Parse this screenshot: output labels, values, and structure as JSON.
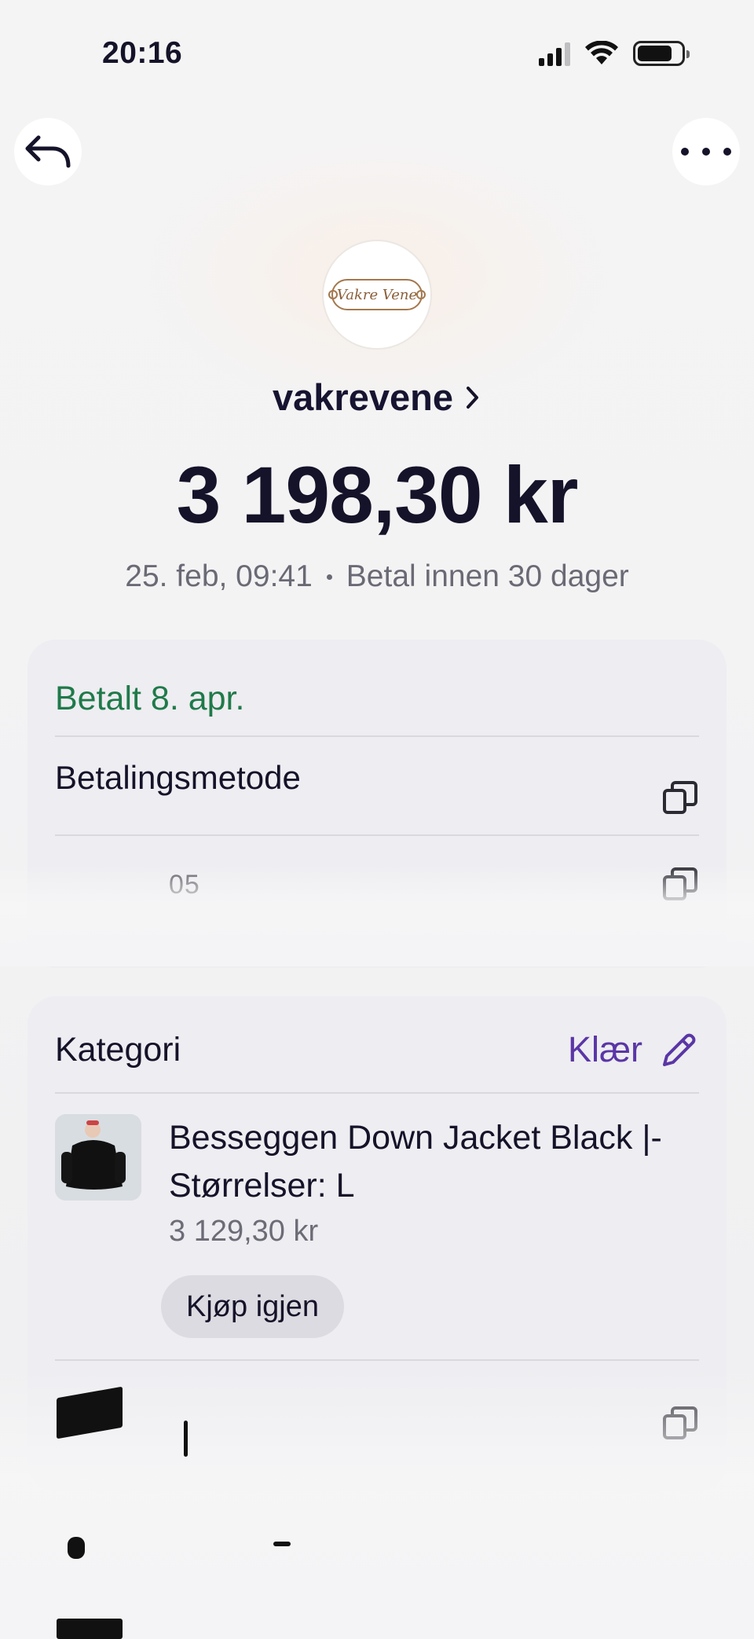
{
  "status_bar": {
    "time": "20:16",
    "icons": [
      "signal-icon",
      "wifi-icon",
      "battery-icon"
    ]
  },
  "nav": {
    "back_icon": "back-arrow-icon",
    "more_icon": "more-icon"
  },
  "merchant": {
    "logo_text": "Vakre Vene",
    "name": "vakrevene",
    "chevron_icon": "chevron-right-icon"
  },
  "transaction": {
    "amount": "3 198,30 kr",
    "date": "25. feb, 09:41",
    "due": "Betal innen 30 dager"
  },
  "payment_card": {
    "status": "Betalt 8. apr.",
    "method_label": "Betalingsmetode",
    "reference": "05",
    "copy_icon": "copy-icon"
  },
  "category_card": {
    "label": "Kategori",
    "value": "Klær",
    "edit_icon": "pencil-icon",
    "item": {
      "title": "Besseggen Down Jacket Black |- Størrelser: L",
      "price": "3 129,30 kr",
      "rebuy_label": "Kjøp igjen"
    }
  },
  "colors": {
    "paid_green": "#1f7a4a",
    "accent_purple": "#5a36a6",
    "text_primary": "#151329",
    "text_secondary": "#6a6a75",
    "card_bg": "#eeedf1"
  }
}
